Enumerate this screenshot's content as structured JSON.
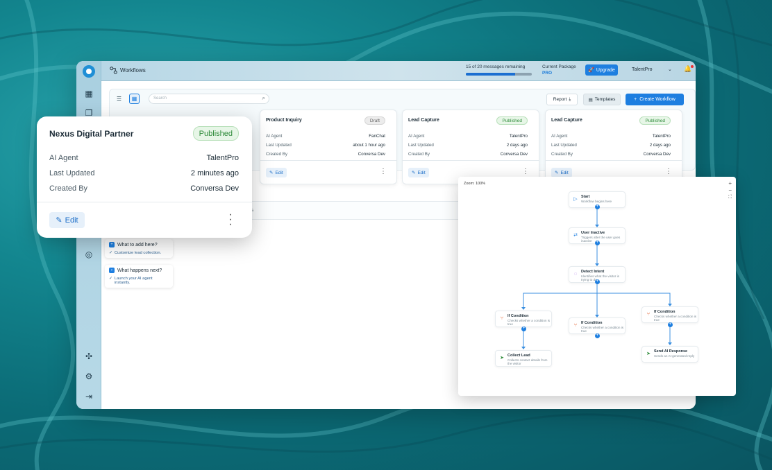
{
  "app": {
    "title": "Workflows",
    "messages_text": "15 of 20 messages remaining",
    "messages_progress": 0.75,
    "package_label": "Current Package",
    "package_value": "PRO",
    "upgrade_label": "Upgrade",
    "account_name": "TalentPro"
  },
  "toolbar": {
    "search_placeholder": "Search",
    "report_label": "Report",
    "templates_label": "Templates",
    "create_label": "Create Workflow"
  },
  "cards": [
    {
      "title": "Product Inquiry",
      "status": "Draft",
      "agent_label": "AI Agent",
      "agent": "FanChat",
      "updated_label": "Last Updated",
      "updated": "about 1 hour ago",
      "created_label": "Created By",
      "created": "Conversa Dev",
      "edit": "Edit"
    },
    {
      "title": "Lead Capture",
      "status": "Published",
      "agent_label": "AI Agent",
      "agent": "TalentPro",
      "updated_label": "Last Updated",
      "updated": "2 days ago",
      "created_label": "Created By",
      "created": "Conversa Dev",
      "edit": "Edit"
    },
    {
      "title": "Lead Capture",
      "status": "Published",
      "agent_label": "AI Agent",
      "agent": "TalentPro",
      "updated_label": "Last Updated",
      "updated": "2 days ago",
      "created_label": "Created By",
      "created": "Conversa Dev",
      "edit": "Edit"
    }
  ],
  "featured_card": {
    "title": "Nexus Digital Partner",
    "status": "Published",
    "agent_label": "AI Agent",
    "agent": "TalentPro",
    "updated_label": "Last Updated",
    "updated": "2 minutes ago",
    "created_label": "Created By",
    "created": "Conversa Dev",
    "edit": "Edit"
  },
  "tips": [
    {
      "title": "What to add here?",
      "body": "Customize lead collection."
    },
    {
      "title": "What happens next?",
      "body": "Launch your AI agent instantly."
    }
  ],
  "strip_fragment": "s",
  "canvas": {
    "zoom_label": "Zoom: 100%",
    "nodes": [
      {
        "title": "Start",
        "desc": "Workflow begins here",
        "icon": "play-icon"
      },
      {
        "title": "User Inactive",
        "desc": "Triggers after the user goes inactive",
        "icon": "sync-icon"
      },
      {
        "title": "Detect Intent",
        "desc": "Identifies what the visitor is trying to do",
        "icon": "target-icon"
      },
      {
        "title": "If Condition",
        "desc": "Checks whether a condition is true",
        "icon": "branch-icon"
      },
      {
        "title": "If Condition",
        "desc": "Checks whether a condition is true",
        "icon": "branch-icon"
      },
      {
        "title": "If Condition",
        "desc": "Checks whether a condition is true",
        "icon": "branch-icon"
      },
      {
        "title": "Collect Lead",
        "desc": "Collects contact details from the visitor",
        "icon": "send-icon"
      },
      {
        "title": "Send AI Response",
        "desc": "Sends an AI-generated reply",
        "icon": "send-icon"
      }
    ]
  },
  "colors": {
    "accent": "#1e7fe0",
    "published_bg": "#e7f6e7",
    "published_text": "#2e8b3a",
    "sidebar": "#a9cfe0"
  }
}
